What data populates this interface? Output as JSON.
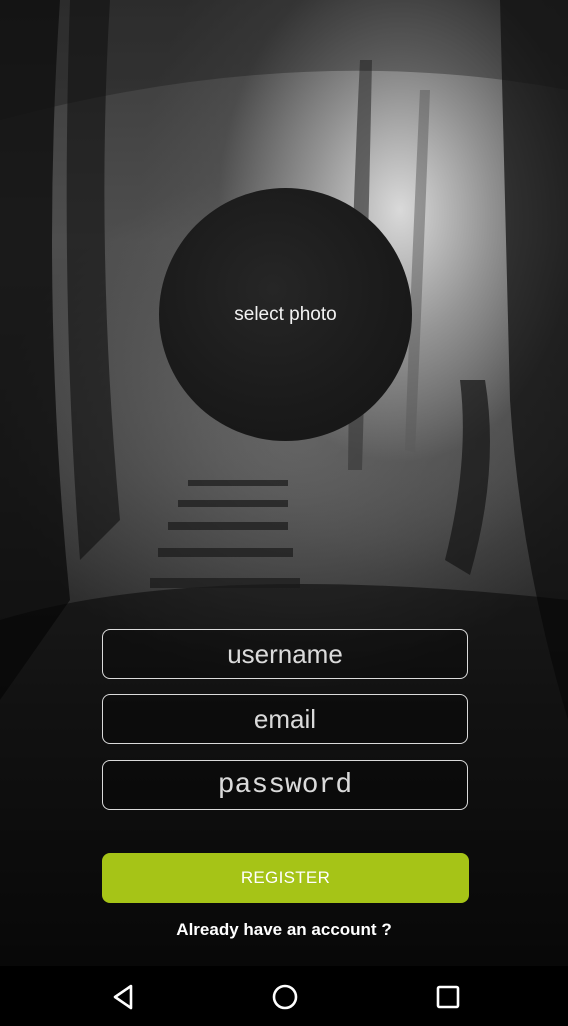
{
  "photo": {
    "label": "select photo"
  },
  "form": {
    "username_placeholder": "username",
    "email_placeholder": "email",
    "password_placeholder": "password"
  },
  "actions": {
    "register_label": "REGISTER",
    "login_link": "Already have an account ?"
  },
  "navbar": {
    "buttons": [
      "back-icon",
      "home-icon",
      "recents-icon"
    ]
  },
  "colors": {
    "accent": "#a6c417",
    "navbar_bg": "#000000"
  }
}
